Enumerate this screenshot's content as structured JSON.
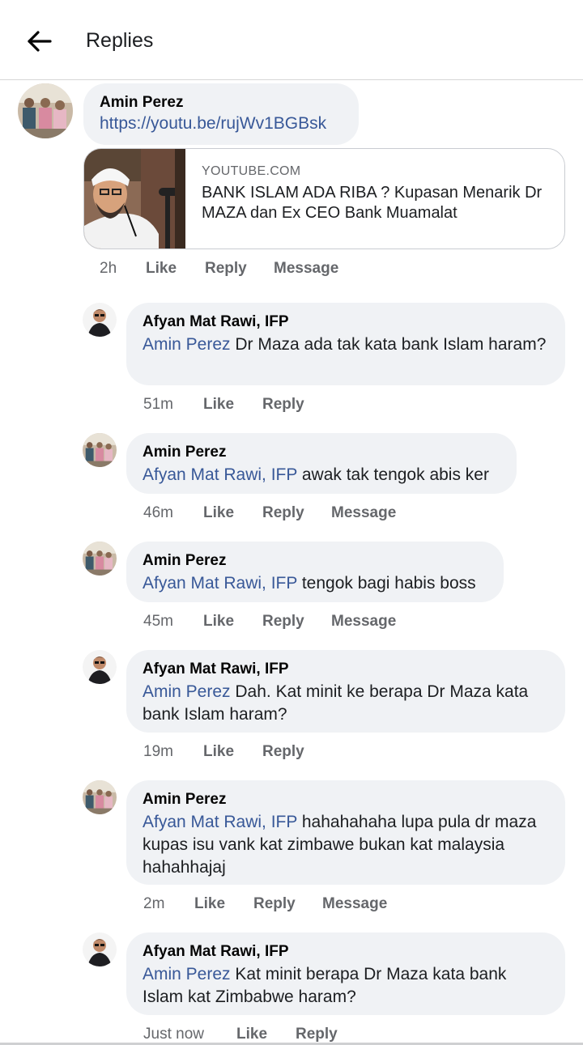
{
  "header": {
    "title": "Replies"
  },
  "root": {
    "author": "Amin Perez",
    "link": "https://youtu.be/rujWv1BGBsk",
    "card": {
      "domain": "YOUTUBE.COM",
      "title": "BANK ISLAM ADA RIBA ? Kupasan Menarik Dr MAZA dan Ex CEO Bank Muamalat"
    },
    "time": "2h",
    "like": "Like",
    "reply": "Reply",
    "message": "Message"
  },
  "replies": [
    {
      "author": "Afyan Mat Rawi, IFP",
      "mention": "Amin Perez",
      "text": " Dr Maza ada tak kata bank Islam haram?",
      "time": "51m",
      "like": "Like",
      "reply": "Reply"
    },
    {
      "author": "Amin Perez",
      "mention": "Afyan Mat Rawi, IFP",
      "text": " awak tak tengok abis ker",
      "time": "46m",
      "like": "Like",
      "reply": "Reply",
      "message": "Message"
    },
    {
      "author": "Amin Perez",
      "mention": "Afyan Mat Rawi, IFP",
      "text": " tengok bagi habis boss",
      "time": "45m",
      "like": "Like",
      "reply": "Reply",
      "message": "Message"
    },
    {
      "author": "Afyan Mat Rawi, IFP",
      "mention": "Amin Perez",
      "text": " Dah. Kat minit ke berapa Dr Maza kata bank Islam haram?",
      "time": "19m",
      "like": "Like",
      "reply": "Reply"
    },
    {
      "author": "Amin Perez",
      "mention": "Afyan Mat Rawi, IFP",
      "text": " hahahahaha lupa pula dr maza kupas isu vank kat zimbawe bukan kat malaysia hahahhajaj",
      "time": "2m",
      "like": "Like",
      "reply": "Reply",
      "message": "Message"
    },
    {
      "author": "Afyan Mat Rawi, IFP",
      "mention": "Amin Perez",
      "text": " Kat minit berapa Dr Maza kata bank Islam kat Zimbabwe haram?",
      "time": "Just now",
      "like": "Like",
      "reply": "Reply"
    }
  ]
}
